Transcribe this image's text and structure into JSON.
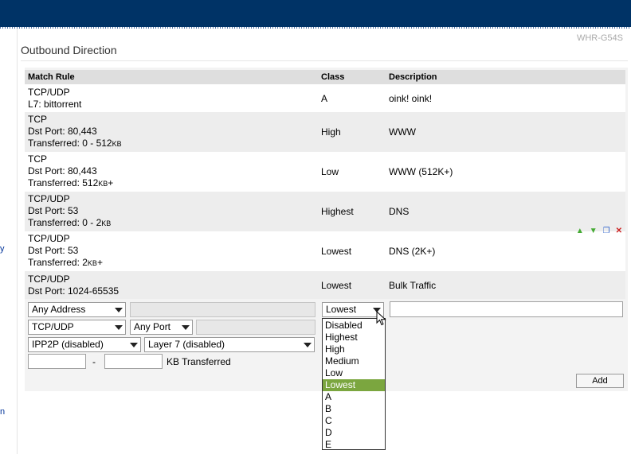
{
  "model": "WHR-G54S",
  "section_title": "Outbound Direction",
  "table": {
    "headers": {
      "match_rule": "Match Rule",
      "class": "Class",
      "description": "Description"
    },
    "rows": [
      {
        "match": [
          "TCP/UDP",
          "L7: bittorrent"
        ],
        "class": "A",
        "description": "oink! oink!"
      },
      {
        "match": [
          "TCP",
          "Dst Port: 80,443",
          "Transferred: 0 - 512KB"
        ],
        "class": "High",
        "description": "WWW"
      },
      {
        "match": [
          "TCP",
          "Dst Port: 80,443",
          "Transferred: 512KB+"
        ],
        "class": "Low",
        "description": "WWW (512K+)"
      },
      {
        "match": [
          "TCP/UDP",
          "Dst Port: 53",
          "Transferred: 0 - 2KB"
        ],
        "class": "Highest",
        "description": "DNS"
      },
      {
        "match": [
          "TCP/UDP",
          "Dst Port: 53",
          "Transferred: 2KB+"
        ],
        "class": "Lowest",
        "description": "DNS (2K+)"
      },
      {
        "match": [
          "TCP/UDP",
          "Dst Port: 1024-65535"
        ],
        "class": "Lowest",
        "description": "Bulk Traffic"
      }
    ]
  },
  "form": {
    "address_select": "Any Address",
    "protocol_select": "TCP/UDP",
    "port_select": "Any Port",
    "ipp2p_select": "IPP2P (disabled)",
    "layer7_select": "Layer 7 (disabled)",
    "range_separator": "-",
    "kb_label": "KB Transferred",
    "class_select": "Lowest",
    "add_button": "Add"
  },
  "class_options": [
    "Disabled",
    "Highest",
    "High",
    "Medium",
    "Low",
    "Lowest",
    "A",
    "B",
    "C",
    "D",
    "E"
  ],
  "selected_class": "Lowest",
  "side_glyphs": [
    "y",
    "n"
  ],
  "colors": {
    "header_bar": "#003366",
    "selected_option": "#7ba63f"
  }
}
